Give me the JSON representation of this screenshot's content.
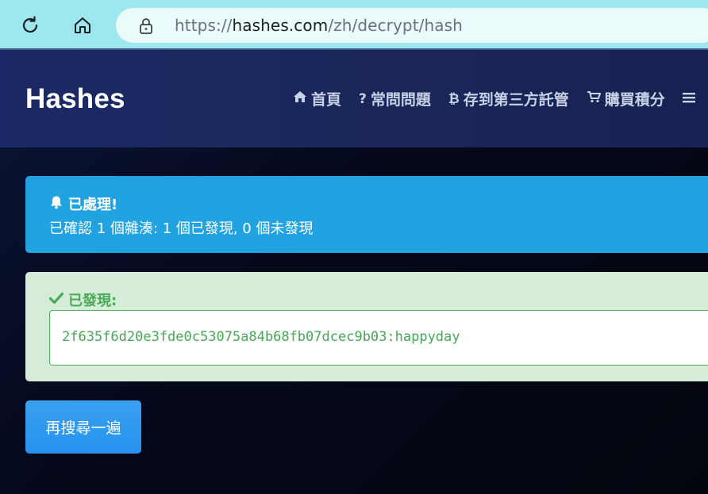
{
  "browser": {
    "url_scheme": "https://",
    "url_domain": "hashes.com",
    "url_path": "/zh/decrypt/hash"
  },
  "header": {
    "brand": "Hashes",
    "nav": [
      {
        "label": "首頁",
        "icon": "home-icon"
      },
      {
        "label": "常問問題",
        "icon": "question-icon"
      },
      {
        "label": "存到第三方託管",
        "icon": "bitcoin-icon"
      },
      {
        "label": "購買積分",
        "icon": "cart-icon"
      }
    ]
  },
  "processed_alert": {
    "title": "已處理!",
    "text": "已確認 1 個雜湊: 1 個已發現, 0 個未發現"
  },
  "found_alert": {
    "title": "已發現:",
    "result": "2f635f6d20e3fde0c53075a84b68fb07dcec9b03:happyday"
  },
  "actions": {
    "search_again": "再搜尋一遍"
  },
  "colors": {
    "toolbar": "#9de8ee",
    "header": "#1b2a66",
    "info": "#21a3e1",
    "success_bg": "#d5ecd9",
    "success_text": "#4aaa56",
    "button": "#2592ef"
  }
}
